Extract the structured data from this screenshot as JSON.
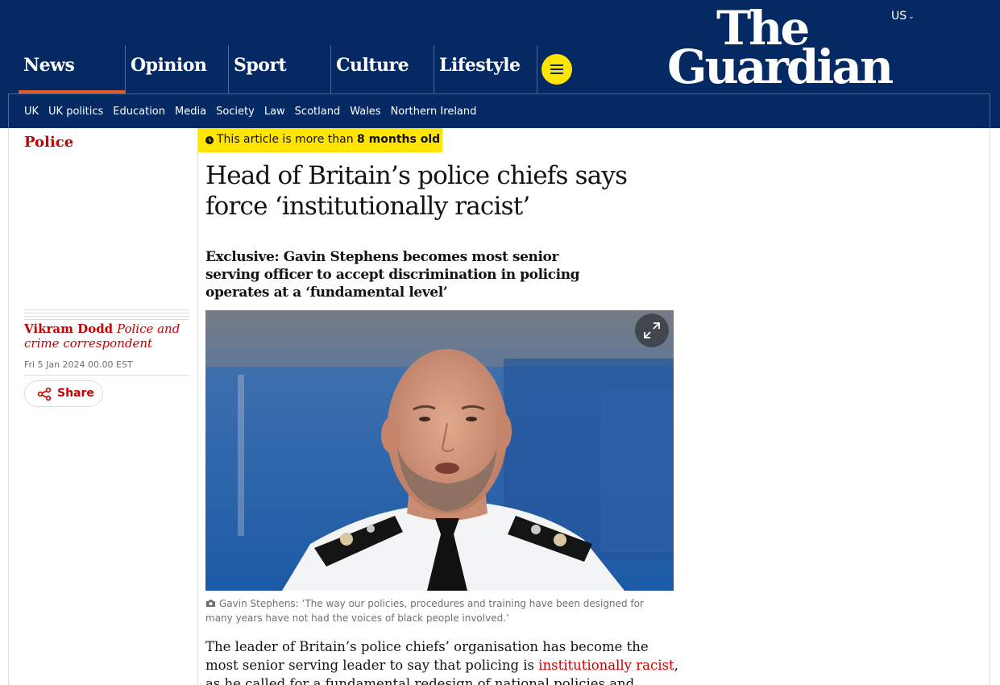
{
  "header": {
    "edition": "US",
    "logo": {
      "line1": "The",
      "line2": "Guardian"
    },
    "pillars": [
      "News",
      "Opinion",
      "Sport",
      "Culture",
      "Lifestyle"
    ],
    "active_pillar": "News",
    "menu_icon": "hamburger-icon",
    "subnav": [
      "UK",
      "UK politics",
      "Education",
      "Media",
      "Society",
      "Law",
      "Scotland",
      "Wales",
      "Northern Ireland"
    ]
  },
  "article": {
    "section": "Police",
    "age_warning": {
      "prefix": "This article is more than ",
      "age": "8 months old"
    },
    "headline": "Head of Britain’s police chiefs says force ‘institutionally racist’",
    "standfirst": "Exclusive: Gavin Stephens becomes most senior serving officer to accept discrimination in policing operates at a ‘fundamental level’",
    "byline": {
      "name": "Vikram Dodd",
      "role": "Police and crime correspondent"
    },
    "date": "Fri 5 Jan 2024 00.00 EST",
    "share_label": "Share",
    "caption": "Gavin Stephens: ‘The way our policies, procedures and training have been designed for many years have not had the voices of black people involved.’",
    "body": {
      "before_link": "The leader of Britain’s police chiefs’ organisation has become the most senior serving leader to say that policing is ",
      "link_text": "institutionally racist",
      "after_link": ", as he called for a fundamental redesign of national policies and practices to eliminate"
    }
  },
  "colors": {
    "brand_blue": "#052962",
    "accent_red": "#c70000",
    "warning_yellow": "#ffe500",
    "news_orange": "#e05e2a"
  }
}
